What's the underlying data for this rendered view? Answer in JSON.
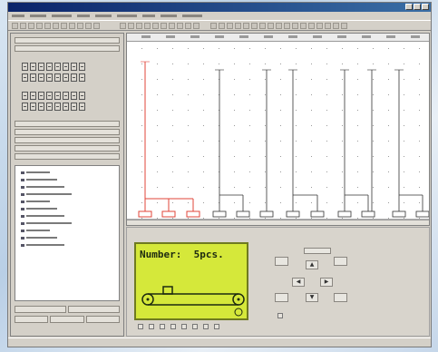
{
  "lcd": {
    "label": "Number:",
    "value": "5pcs.",
    "bg_color": "#d5e83a"
  },
  "accent_red": "#e0443a",
  "menu_count": 9,
  "tree_count": 11,
  "relay_modules": 2
}
